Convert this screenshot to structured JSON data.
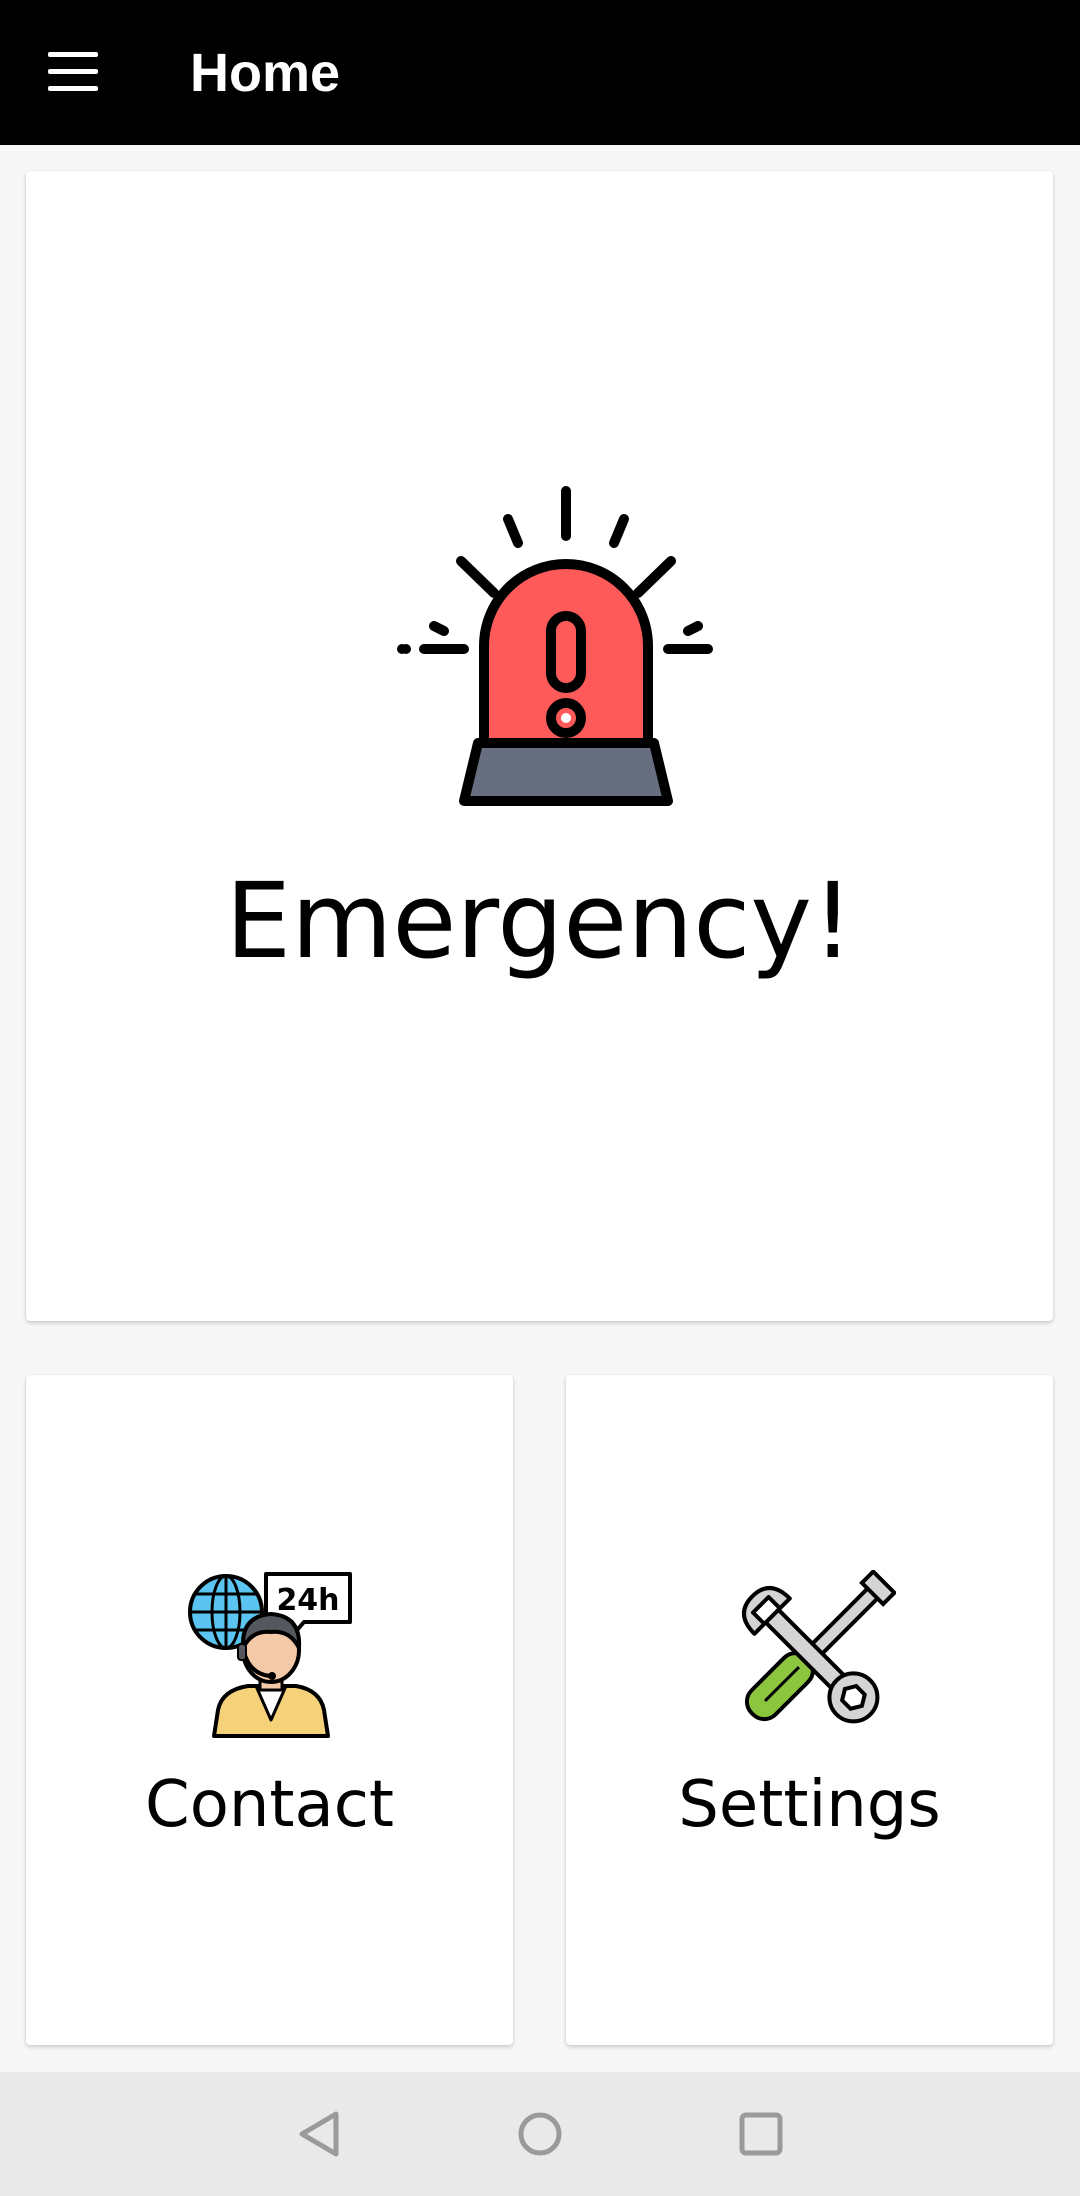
{
  "toolbar": {
    "title": "Home",
    "menu_icon": "hamburger-menu-icon"
  },
  "cards": {
    "emergency": {
      "label": "Emergency!",
      "icon": "siren-alarm-icon",
      "colors": {
        "light": "#ff5a5a",
        "base": "#666e80",
        "outline": "#000000"
      }
    },
    "contact": {
      "label": "Contact",
      "icon": "support-agent-24h-icon",
      "badge_text": "24h",
      "colors": {
        "globe": "#5bc4f0",
        "suit": "#f5d17a",
        "skin": "#f4c9a8",
        "hair": "#55575e"
      }
    },
    "settings": {
      "label": "Settings",
      "icon": "wrench-screwdriver-icon",
      "colors": {
        "metal": "#d4d4d4",
        "handle": "#8cc63f"
      }
    }
  },
  "navbar": {
    "back_icon": "back-triangle-icon",
    "home_icon": "home-circle-icon",
    "recents_icon": "recents-square-icon"
  }
}
